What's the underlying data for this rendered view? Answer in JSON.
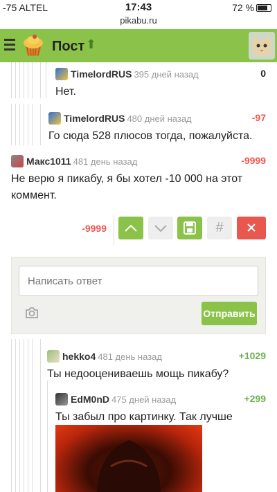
{
  "status": {
    "carrier": "-75 ALTEL",
    "time": "17:43",
    "battery": "72 %"
  },
  "url": "pikabu.ru",
  "nav": {
    "title": "Пост"
  },
  "comments": [
    {
      "author": "TimelordRUS",
      "time": "395 дней назад",
      "score": "0",
      "text": "Нет."
    },
    {
      "author": "TimelordRUS",
      "time": "480 дней назад",
      "score": "-97",
      "text": "Го сюда 528 плюсов тогда, пожалуйста."
    },
    {
      "author": "Макс1011",
      "time": "481 день назад",
      "score": "-9999",
      "text": "Не верю я пикабу, я бы хотел -10 000 на этот коммент."
    },
    {
      "author": "hekko4",
      "time": "481 день назад",
      "score": "+1029",
      "text": "Ты недооцениваешь мощь пикабу?"
    },
    {
      "author": "EdM0nD",
      "time": "475 дней назад",
      "score": "+299",
      "text": "Ты забыл про картинку. Так лучше"
    }
  ],
  "vote_bar": {
    "score": "-9999",
    "hash": "#"
  },
  "reply": {
    "placeholder": "Написать ответ",
    "send": "Отправить"
  },
  "colors": {
    "brand": "#8bc34a",
    "negative": "#e8584f",
    "positive": "#6ab04c"
  },
  "icons": [
    "hamburger-menu-icon",
    "cupcake-logo-icon",
    "up-arrow-icon",
    "cat-avatar",
    "upvote-chevron-icon",
    "downvote-chevron-icon",
    "save-floppy-icon",
    "hash-icon",
    "close-icon",
    "camera-icon"
  ]
}
